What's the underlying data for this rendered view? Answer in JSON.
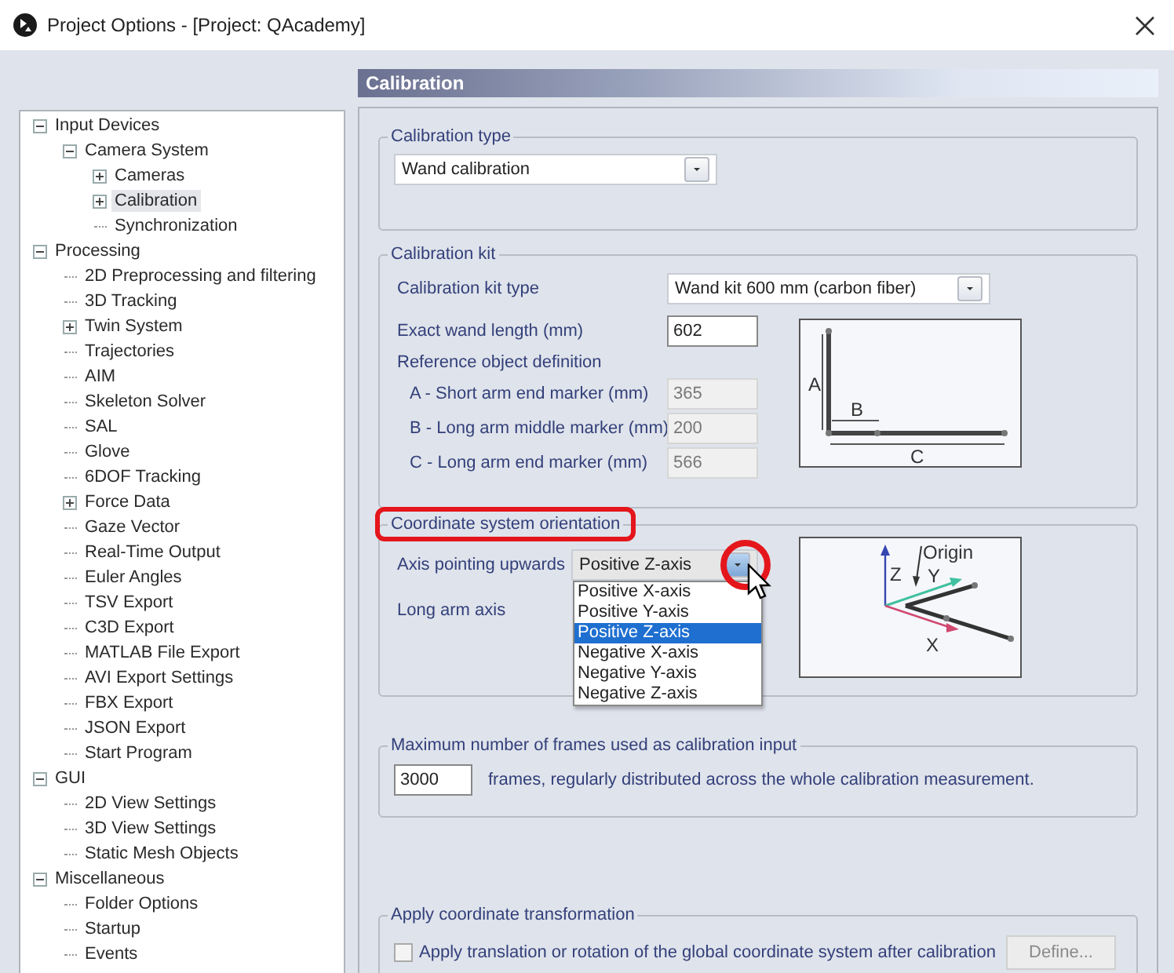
{
  "window": {
    "title": "Project Options - [Project: QAcademy]"
  },
  "tree": [
    {
      "label": "Input Devices",
      "expanded": true,
      "selected": false,
      "children": [
        {
          "label": "Camera System",
          "expanded": true,
          "selected": false,
          "children": [
            {
              "label": "Cameras",
              "expanded": false,
              "selected": false
            },
            {
              "label": "Calibration",
              "expanded": false,
              "selected": true
            },
            {
              "label": "Synchronization",
              "selected": false
            }
          ]
        }
      ]
    },
    {
      "label": "Processing",
      "expanded": true,
      "selected": false,
      "children": [
        {
          "label": "2D Preprocessing and filtering",
          "selected": false
        },
        {
          "label": "3D Tracking",
          "selected": false
        },
        {
          "label": "Twin System",
          "expanded": false,
          "selected": false
        },
        {
          "label": "Trajectories",
          "selected": false
        },
        {
          "label": "AIM",
          "selected": false
        },
        {
          "label": "Skeleton Solver",
          "selected": false
        },
        {
          "label": "SAL",
          "selected": false
        },
        {
          "label": "Glove",
          "selected": false
        },
        {
          "label": "6DOF Tracking",
          "selected": false
        },
        {
          "label": "Force Data",
          "expanded": false,
          "selected": false
        },
        {
          "label": "Gaze Vector",
          "selected": false
        },
        {
          "label": "Real-Time Output",
          "selected": false
        },
        {
          "label": "Euler Angles",
          "selected": false
        },
        {
          "label": "TSV Export",
          "selected": false
        },
        {
          "label": "C3D Export",
          "selected": false
        },
        {
          "label": "MATLAB File Export",
          "selected": false
        },
        {
          "label": "AVI Export Settings",
          "selected": false
        },
        {
          "label": "FBX Export",
          "selected": false
        },
        {
          "label": "JSON Export",
          "selected": false
        },
        {
          "label": "Start Program",
          "selected": false
        }
      ]
    },
    {
      "label": "GUI",
      "expanded": true,
      "selected": false,
      "children": [
        {
          "label": "2D View Settings",
          "selected": false
        },
        {
          "label": "3D View Settings",
          "selected": false
        },
        {
          "label": "Static Mesh Objects",
          "selected": false
        }
      ]
    },
    {
      "label": "Miscellaneous",
      "expanded": true,
      "selected": false,
      "children": [
        {
          "label": "Folder Options",
          "selected": false
        },
        {
          "label": "Startup",
          "selected": false
        },
        {
          "label": "Events",
          "selected": false
        }
      ]
    }
  ],
  "header": "Calibration",
  "calibration_type": {
    "legend": "Calibration type",
    "value": "Wand calibration"
  },
  "calibration_kit": {
    "legend": "Calibration kit",
    "kit_type_label": "Calibration kit type",
    "kit_type_value": "Wand kit 600 mm (carbon fiber)",
    "wand_length_label": "Exact wand length (mm)",
    "wand_length_value": "602",
    "reference_heading": "Reference object definition",
    "markers": [
      {
        "label": "A - Short arm end marker (mm)",
        "value": "365",
        "disabled": true
      },
      {
        "label": "B - Long arm middle marker (mm)",
        "value": "200",
        "disabled": true
      },
      {
        "label": "C - Long arm end marker (mm)",
        "value": "566",
        "disabled": true
      }
    ],
    "diagram_labels": {
      "a": "A",
      "b": "B",
      "c": "C"
    }
  },
  "orientation": {
    "legend": "Coordinate system orientation",
    "legend_highlighted": true,
    "upward_label": "Axis pointing upwards",
    "upward_value": "Positive Z-axis",
    "button_highlighted": true,
    "open": true,
    "long_arm_label": "Long arm axis",
    "options": [
      {
        "label": "Positive X-axis",
        "selected": false
      },
      {
        "label": "Positive Y-axis",
        "selected": false
      },
      {
        "label": "Positive Z-axis",
        "selected": true
      },
      {
        "label": "Negative X-axis",
        "selected": false
      },
      {
        "label": "Negative Y-axis",
        "selected": false
      },
      {
        "label": "Negative Z-axis",
        "selected": false
      }
    ],
    "diagram_labels": {
      "origin": "Origin",
      "x": "X",
      "y": "Y",
      "z": "Z"
    }
  },
  "max_frames": {
    "legend": "Maximum number of frames used as calibration input",
    "value": "3000",
    "note": "frames, regularly distributed across the whole calibration measurement."
  },
  "transformation": {
    "legend": "Apply coordinate transformation",
    "checkbox_label": "Apply translation or rotation of the global coordinate system after calibration",
    "checked": false,
    "define_button": "Define...",
    "define_disabled": true
  }
}
